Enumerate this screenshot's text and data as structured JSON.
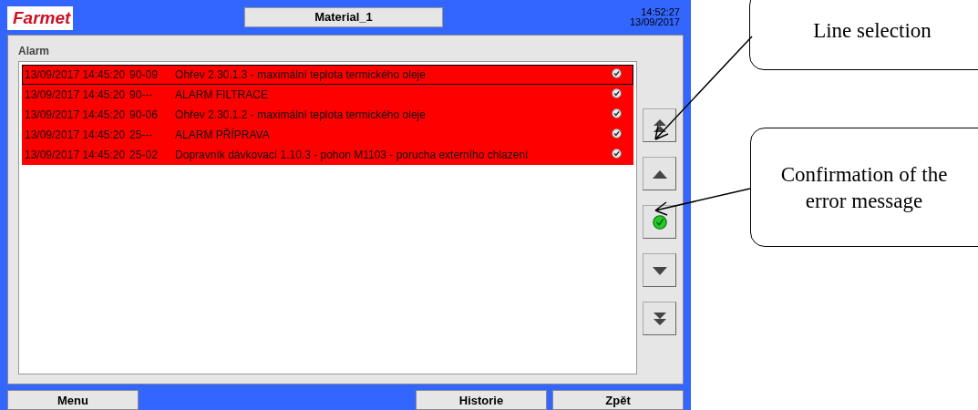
{
  "header": {
    "logo": "Farmet",
    "title": "Material_1",
    "time": "14:52:27",
    "date": "13/09/2017"
  },
  "panel": {
    "title": "Alarm"
  },
  "alarms": [
    {
      "timestamp": "13/09/2017 14:45:20",
      "code": "90-09",
      "message": "Ohřev 2.30.1.3 - maximální teplota termického oleje",
      "selected": true
    },
    {
      "timestamp": "13/09/2017 14:45:20",
      "code": "90---",
      "message": "ALARM FILTRACE",
      "selected": false
    },
    {
      "timestamp": "13/09/2017 14:45:20",
      "code": "90-06",
      "message": "Ohřev 2.30.1.2 - maximální teplota termického oleje",
      "selected": false
    },
    {
      "timestamp": "13/09/2017 14:45:20",
      "code": "25---",
      "message": "ALARM PŘÍPRAVA",
      "selected": false
    },
    {
      "timestamp": "13/09/2017 14:45:20",
      "code": "25-02",
      "message": "Dopravník dávkovací 1.10.3 - pohon M1103 - porucha externího chlazení",
      "selected": false
    }
  ],
  "footer": [
    "Menu",
    "Historie",
    "Zpět"
  ],
  "callouts": [
    {
      "text": "Line selection"
    },
    {
      "text": "Confirmation of the error message"
    }
  ]
}
